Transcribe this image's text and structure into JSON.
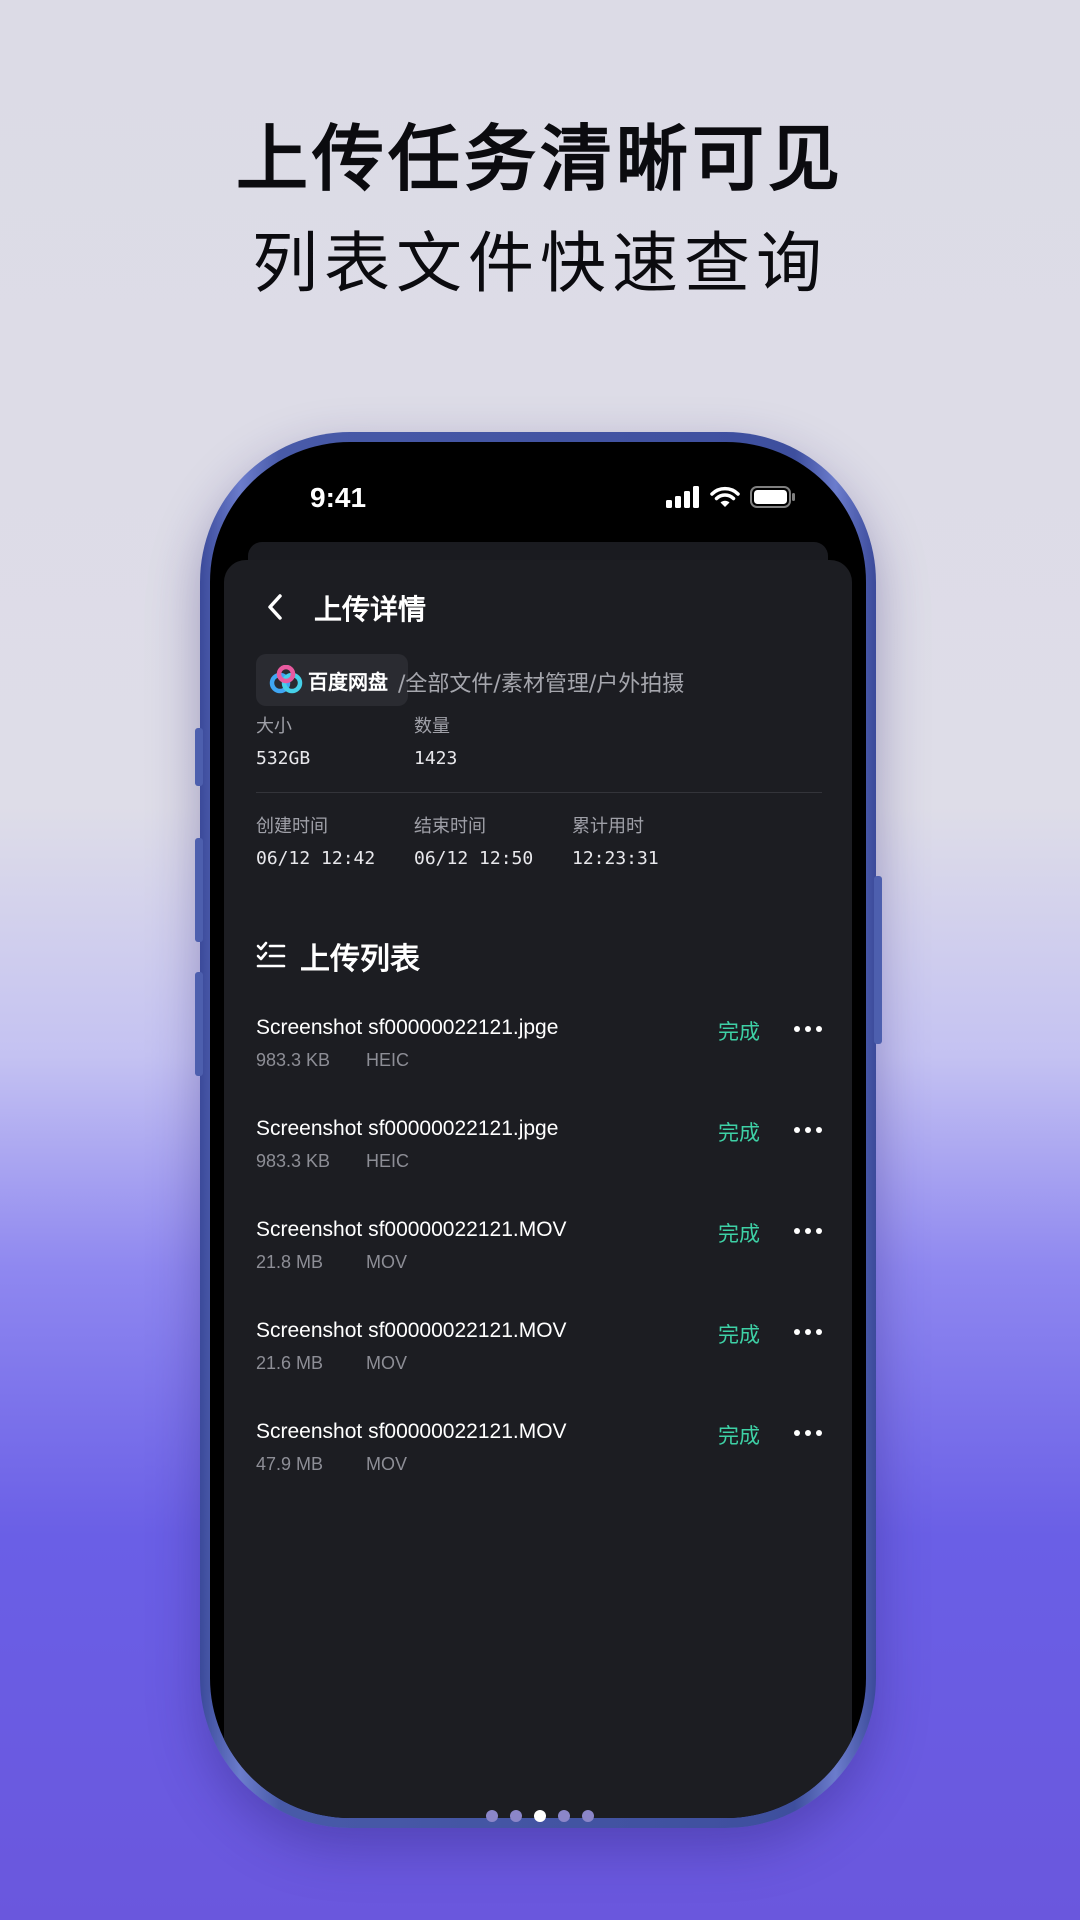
{
  "headline": {
    "line1": "上传任务清晰可见",
    "line2": "列表文件快速查询"
  },
  "status_bar": {
    "time": "9:41"
  },
  "nav": {
    "title": "上传详情"
  },
  "location": {
    "badge": "百度网盘",
    "path": "/全部文件/素材管理/户外拍摄"
  },
  "summary": [
    {
      "label": "大小",
      "value": "532GB"
    },
    {
      "label": "数量",
      "value": "1423"
    }
  ],
  "timing": [
    {
      "label": "创建时间",
      "value": "06/12 12:42"
    },
    {
      "label": "结束时间",
      "value": "06/12 12:50"
    },
    {
      "label": "累计用时",
      "value": "12:23:31"
    }
  ],
  "list": {
    "title": "上传列表",
    "items": [
      {
        "name": "Screenshot sf00000022121.jpge",
        "size": "983.3 KB",
        "type": "HEIC",
        "status": "完成"
      },
      {
        "name": "Screenshot sf00000022121.jpge",
        "size": "983.3 KB",
        "type": "HEIC",
        "status": "完成"
      },
      {
        "name": "Screenshot sf00000022121.MOV",
        "size": "21.8 MB",
        "type": "MOV",
        "status": "完成"
      },
      {
        "name": "Screenshot sf00000022121.MOV",
        "size": "21.6 MB",
        "type": "MOV",
        "status": "完成"
      },
      {
        "name": "Screenshot sf00000022121.MOV",
        "size": "47.9 MB",
        "type": "MOV",
        "status": "完成"
      }
    ]
  },
  "pager": {
    "count": 5,
    "active": 3
  },
  "colors": {
    "accent": "#3ed1a6",
    "sheet": "#1c1d22"
  },
  "icons": [
    "back-chevron-icon",
    "baidu-netdisk-logo-icon",
    "checklist-icon",
    "more-icon",
    "signal-icon",
    "wifi-icon",
    "battery-icon"
  ]
}
